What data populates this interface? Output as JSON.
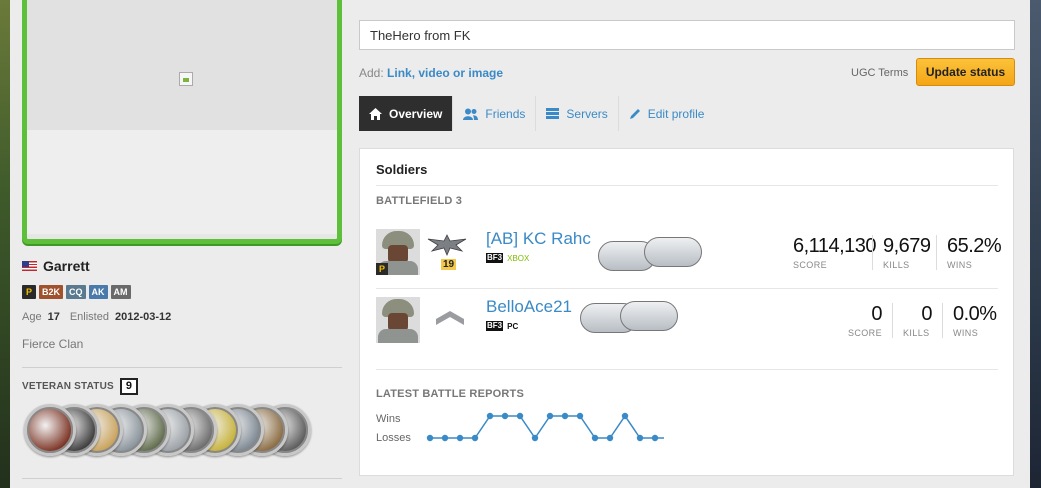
{
  "profile": {
    "name": "Garrett",
    "country_flag": "us-flag-icon",
    "clan_tags": [
      "P",
      "B2K",
      "CQ",
      "AK",
      "AM"
    ],
    "age_label": "Age",
    "age": "17",
    "enlisted_label": "Enlisted",
    "enlisted": "2012-03-12",
    "clan": "Fierce Clan",
    "veteran_label": "VETERAN STATUS",
    "veteran_count": "9",
    "medal_count": 11
  },
  "status": {
    "value": "TheHero from FK",
    "add_label": "Add:",
    "add_link": "Link, video or image",
    "ugc_terms": "UGC Terms",
    "update_button": "Update status"
  },
  "tabs": [
    {
      "label": "Overview",
      "icon": "home-icon",
      "active": true
    },
    {
      "label": "Friends",
      "icon": "users-icon",
      "active": false
    },
    {
      "label": "Servers",
      "icon": "list-icon",
      "active": false
    },
    {
      "label": "Edit profile",
      "icon": "pencil-icon",
      "active": false
    }
  ],
  "soldiers_panel": {
    "title": "Soldiers",
    "game_label": "BATTLEFIELD 3",
    "soldiers": [
      {
        "name": "[AB] KC Rahc",
        "game_badge": "BF3",
        "platform": "XBOX",
        "rank": "19",
        "score_label": "SCORE",
        "score": "6,114,130",
        "kills_label": "KILLS",
        "kills": "9,679",
        "wins_label": "WINS",
        "wins": "65.2%"
      },
      {
        "name": "BelloAce21",
        "game_badge": "BF3",
        "platform": "PC",
        "score_label": "SCORE",
        "score": "0",
        "kills_label": "KILLS",
        "kills": "0",
        "wins_label": "WINS",
        "wins": "0.0%"
      }
    ],
    "reports_label": "LATEST BATTLE REPORTS",
    "wins_legend": "Wins",
    "losses_legend": "Losses",
    "battle_results": [
      "L",
      "L",
      "L",
      "L",
      "W",
      "W",
      "W",
      "L",
      "W",
      "W",
      "W",
      "L",
      "L",
      "W",
      "L",
      "L",
      "L"
    ],
    "line_color": "#3a8ac7"
  }
}
